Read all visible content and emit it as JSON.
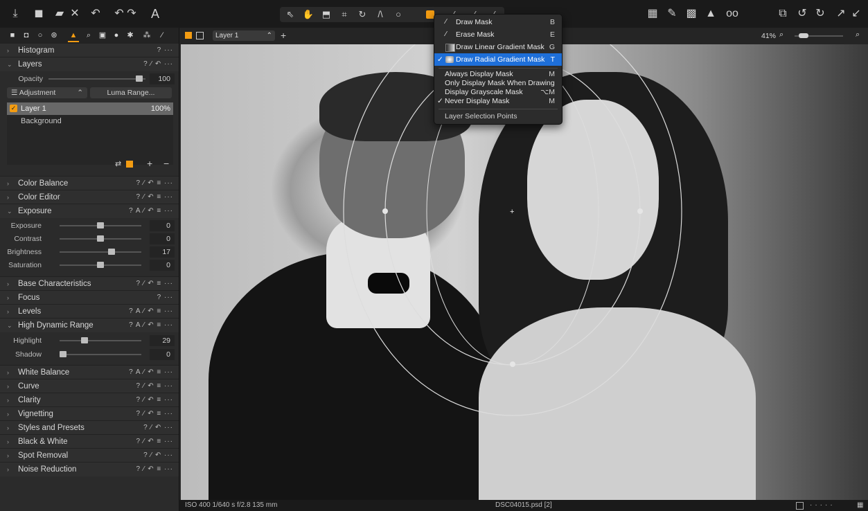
{
  "colors": {
    "accent": "#f39c12",
    "highlight": "#1e6fd9",
    "panel": "#2b2b2b"
  },
  "toolbar": {
    "left_icons": [
      "import-icon",
      "camera-icon",
      "folder-close-icon",
      "undo-icon",
      "redo-icon",
      "text-a-icon"
    ],
    "tools": [
      "cursor-icon",
      "hand-icon",
      "crop-box-icon",
      "crop-icon",
      "rotate-icon",
      "keystone-icon",
      "circle-icon",
      "mask-icon",
      "brush-icon",
      "eraser-icon",
      "pipette-icon"
    ],
    "right_icons": [
      "grid-icon",
      "edit-icon",
      "overlay-icon",
      "warning-icon",
      "glasses-icon",
      "window-icon",
      "rotate-left-icon",
      "rotate-right-icon",
      "expand-icon"
    ]
  },
  "viewer": {
    "layer": "Layer 1",
    "zoom": "41%"
  },
  "panel": {
    "histogram": "Histogram",
    "layers": {
      "title": "Layers",
      "opacity_label": "Opacity",
      "opacity_value": "100",
      "adjustment": "Adjustment",
      "luma": "Luma Range...",
      "items": [
        {
          "name": "Layer 1",
          "value": "100%"
        },
        {
          "name": "Background",
          "value": ""
        }
      ]
    },
    "sections_a": [
      "Color Balance",
      "Color Editor"
    ],
    "exposure": {
      "title": "Exposure",
      "sliders": [
        {
          "label": "Exposure",
          "value": "0",
          "pos": 0.5
        },
        {
          "label": "Contrast",
          "value": "0",
          "pos": 0.5
        },
        {
          "label": "Brightness",
          "value": "17",
          "pos": 0.65
        },
        {
          "label": "Saturation",
          "value": "0",
          "pos": 0.5
        }
      ]
    },
    "sections_b": [
      "Base Characteristics",
      "Focus",
      "Levels"
    ],
    "hdr": {
      "title": "High Dynamic Range",
      "sliders": [
        {
          "label": "Highlight",
          "value": "29",
          "pos": 0.29
        },
        {
          "label": "Shadow",
          "value": "0",
          "pos": 0.0
        }
      ]
    },
    "sections_c": [
      "White Balance",
      "Curve",
      "Clarity",
      "Vignetting",
      "Styles and Presets",
      "Black & White",
      "Spot Removal",
      "Noise Reduction"
    ]
  },
  "status": {
    "exif": "ISO 400   1/640 s   f/2.8   135 mm",
    "file": "DSC04015.psd [2]"
  },
  "menu": {
    "draw_mask": {
      "label": "Draw Mask",
      "key": "B"
    },
    "erase_mask": {
      "label": "Erase Mask",
      "key": "E"
    },
    "linear": {
      "label": "Draw Linear Gradient Mask",
      "key": "G"
    },
    "radial": {
      "label": "Draw Radial Gradient Mask",
      "key": "T"
    },
    "always": {
      "label": "Always Display Mask",
      "key": "M"
    },
    "only": {
      "label": "Only Display Mask When Drawing",
      "key": ""
    },
    "grayscale": {
      "label": "Display Grayscale Mask",
      "key": "⌥M"
    },
    "never": {
      "label": "Never Display Mask",
      "key": "M"
    },
    "points": {
      "label": "Layer Selection Points",
      "key": ""
    }
  }
}
